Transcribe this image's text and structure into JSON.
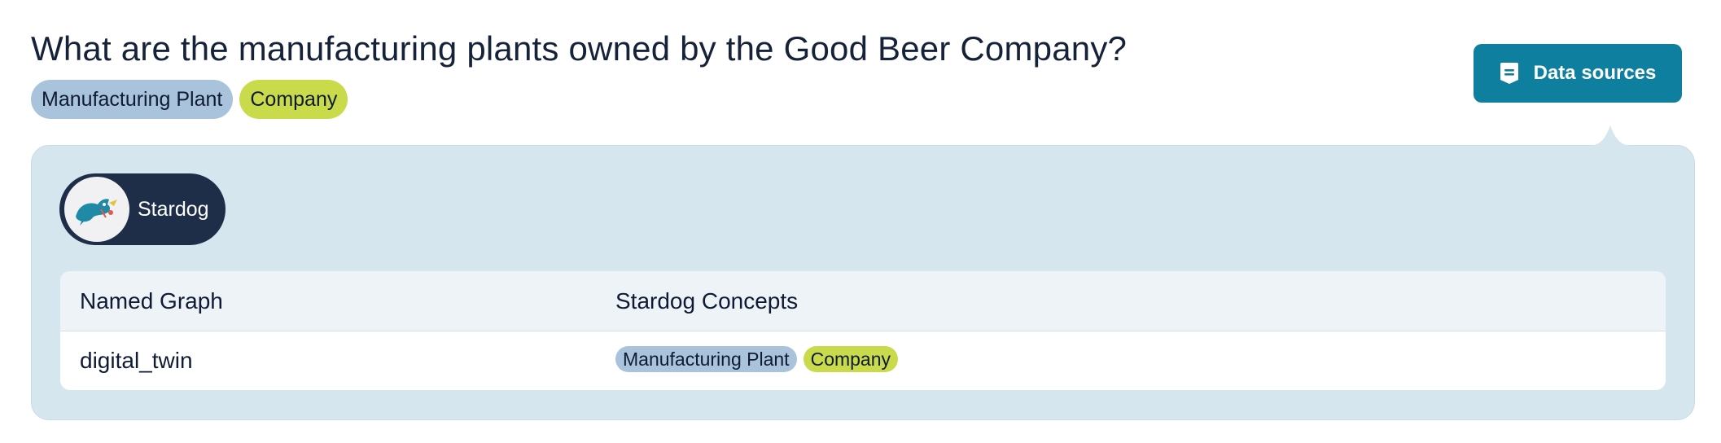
{
  "question": "What are the manufacturing plants owned by the Good Beer Company?",
  "question_tags": [
    "Manufacturing Plant",
    "Company"
  ],
  "data_sources_button": {
    "label": "Data sources",
    "icon": "document-icon"
  },
  "colors": {
    "accent": "#0f7fa0",
    "panel": "#d6e6ef",
    "tag_plant": "#a9c3dc",
    "tag_company": "#c9da4a",
    "pill": "#1e2d48"
  },
  "source": {
    "label": "Stardog",
    "icon": "stardog-logo-icon"
  },
  "table": {
    "headers": {
      "named_graph": "Named Graph",
      "concepts": "Stardog Concepts"
    },
    "rows": [
      {
        "named_graph": "digital_twin",
        "concepts": [
          "Manufacturing Plant",
          "Company"
        ]
      }
    ]
  }
}
